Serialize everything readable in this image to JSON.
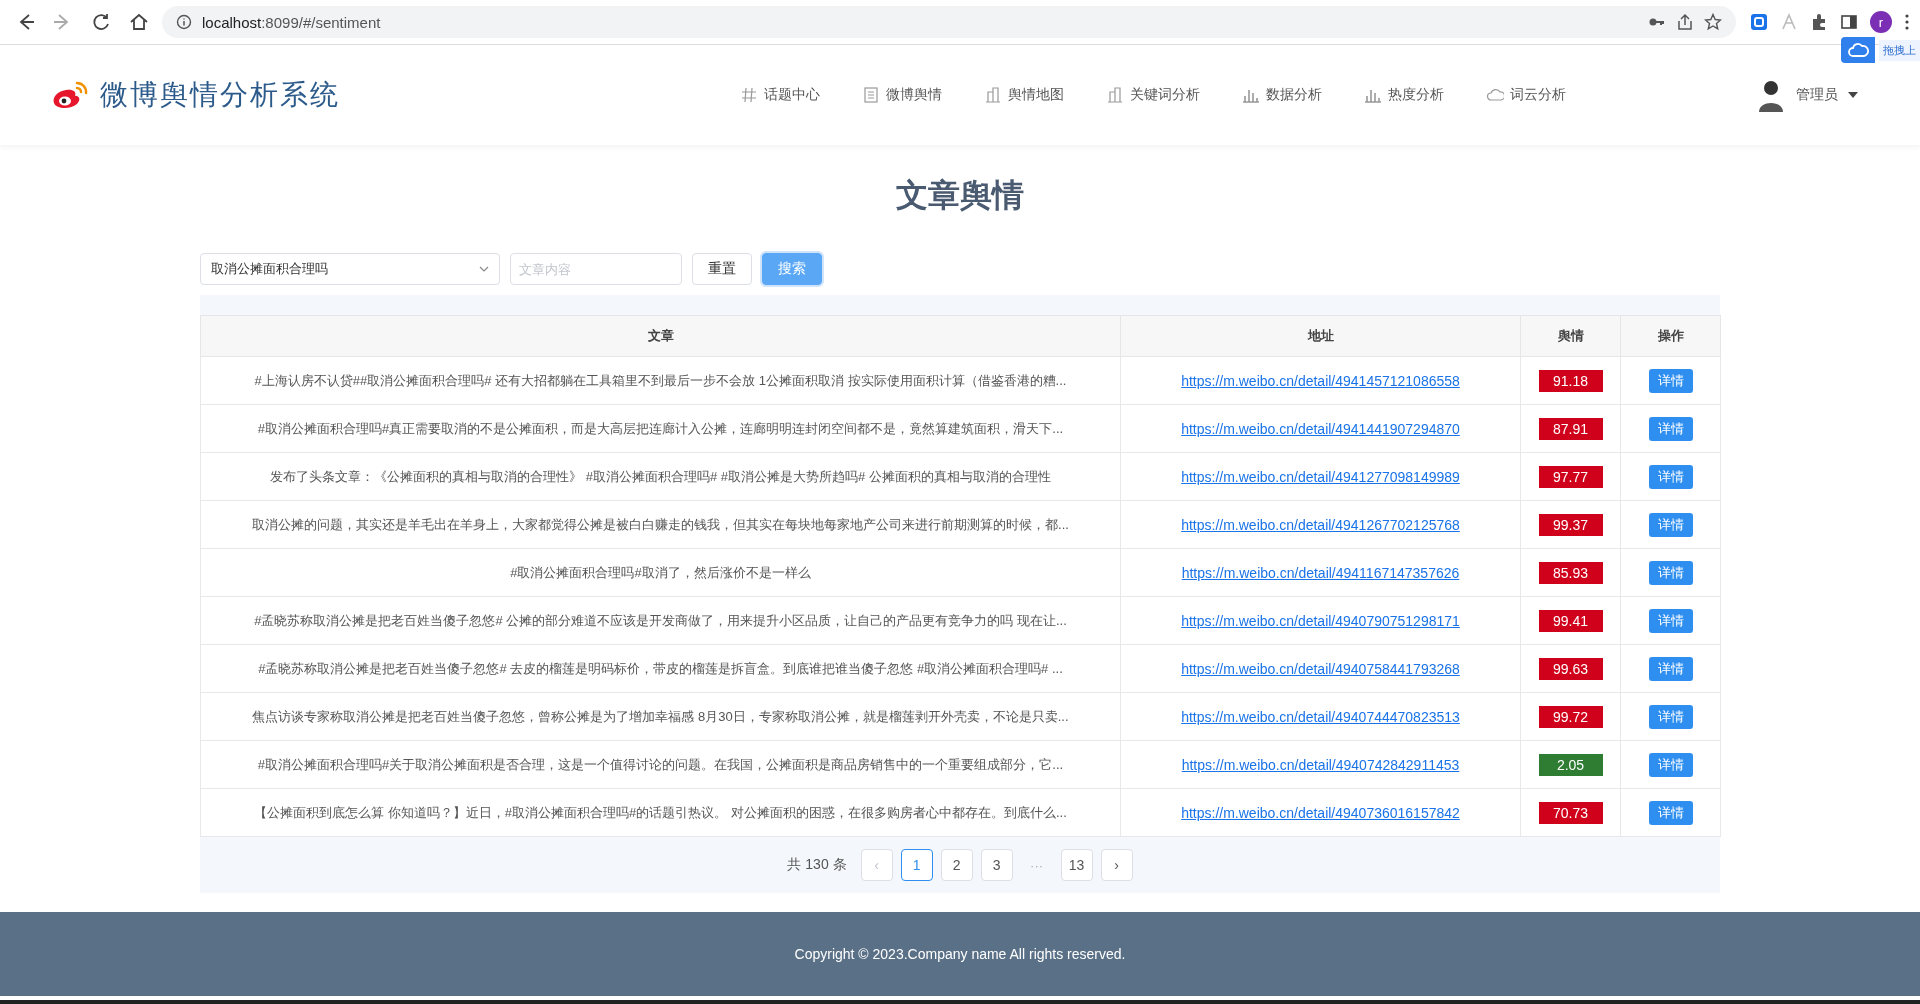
{
  "browser": {
    "url_host": "localhost",
    "url_rest": ":8099/#/sentiment",
    "profile": "r",
    "upload_tip": "拖拽上"
  },
  "header": {
    "logo_text": "微博舆情分析系统",
    "user": "管理员",
    "nav": [
      {
        "label": "话题中心"
      },
      {
        "label": "微博舆情"
      },
      {
        "label": "舆情地图"
      },
      {
        "label": "关键词分析"
      },
      {
        "label": "数据分析"
      },
      {
        "label": "热度分析"
      },
      {
        "label": "词云分析"
      }
    ]
  },
  "page_title": "文章舆情",
  "filters": {
    "topic": "取消公摊面积合理吗",
    "search_placeholder": "文章内容",
    "reset": "重置",
    "search": "搜索"
  },
  "table": {
    "columns": [
      "文章",
      "地址",
      "舆情",
      "操作"
    ],
    "rows": [
      {
        "article": "#上海认房不认贷##取消公摊面积合理吗# 还有大招都躺在工具箱里不到最后一步不会放 1公摊面积取消 按实际使用面积计算（借鉴香港的糟...",
        "url": "https://m.weibo.cn/detail/4941457121086558",
        "score": "91.18",
        "color": "#d0021b",
        "action": "详情"
      },
      {
        "article": "#取消公摊面积合理吗#真正需要取消的不是公摊面积，而是大高层把连廊计入公摊，连廊明明连封闭空间都不是，竟然算建筑面积，滑天下...",
        "url": "https://m.weibo.cn/detail/4941441907294870",
        "score": "87.91",
        "color": "#d0021b",
        "action": "详情"
      },
      {
        "article": "发布了头条文章：《公摊面积的真相与取消的合理性》 #取消公摊面积合理吗# #取消公摊是大势所趋吗# 公摊面积的真相与取消的合理性",
        "url": "https://m.weibo.cn/detail/4941277098149989",
        "score": "97.77",
        "color": "#d0021b",
        "action": "详情"
      },
      {
        "article": "取消公摊的问题，其实还是羊毛出在羊身上，大家都觉得公摊是被白白赚走的钱我，但其实在每块地每家地产公司来进行前期测算的时候，都...",
        "url": "https://m.weibo.cn/detail/4941267702125768",
        "score": "99.37",
        "color": "#d0021b",
        "action": "详情"
      },
      {
        "article": "#取消公摊面积合理吗#取消了，然后涨价不是一样么",
        "url": "https://m.weibo.cn/detail/4941167147357626",
        "score": "85.93",
        "color": "#d0021b",
        "action": "详情"
      },
      {
        "article": "#孟晓苏称取消公摊是把老百姓当傻子忽悠# 公摊的部分难道不应该是开发商做了，用来提升小区品质，让自己的产品更有竞争力的吗 现在让...",
        "url": "https://m.weibo.cn/detail/4940790751298171",
        "score": "99.41",
        "color": "#d0021b",
        "action": "详情"
      },
      {
        "article": "#孟晓苏称取消公摊是把老百姓当傻子忽悠# 去皮的榴莲是明码标价，带皮的榴莲是拆盲盒。到底谁把谁当傻子忽悠 #取消公摊面积合理吗# ...",
        "url": "https://m.weibo.cn/detail/4940758441793268",
        "score": "99.63",
        "color": "#d0021b",
        "action": "详情"
      },
      {
        "article": "焦点访谈专家称取消公摊是把老百姓当傻子忽悠，曾称公摊是为了增加幸福感 8月30日，专家称取消公摊，就是榴莲剥开外壳卖，不论是只卖...",
        "url": "https://m.weibo.cn/detail/4940744470823513",
        "score": "99.72",
        "color": "#d0021b",
        "action": "详情"
      },
      {
        "article": "#取消公摊面积合理吗#关于取消公摊面积是否合理，这是一个值得讨论的问题。在我国，公摊面积是商品房销售中的一个重要组成部分，它...",
        "url": "https://m.weibo.cn/detail/4940742842911453",
        "score": "2.05",
        "color": "#2e7d32",
        "action": "详情"
      },
      {
        "article": "【公摊面积到底怎么算 你知道吗？】近日，#取消公摊面积合理吗#的话题引热议。 对公摊面积的困惑，在很多购房者心中都存在。到底什么...",
        "url": "https://m.weibo.cn/detail/4940736016157842",
        "score": "70.73",
        "color": "#d0021b",
        "action": "详情"
      }
    ]
  },
  "pagination": {
    "total": "共 130 条",
    "prev": "‹",
    "next": "›",
    "pages": [
      {
        "label": "1",
        "selected": true,
        "kind": "page"
      },
      {
        "label": "2",
        "selected": false,
        "kind": "page"
      },
      {
        "label": "3",
        "selected": false,
        "kind": "page"
      },
      {
        "label": "···",
        "selected": false,
        "kind": "more"
      },
      {
        "label": "13",
        "selected": false,
        "kind": "page"
      }
    ]
  },
  "footer": "Copyright © 2023.Company name All rights reserved."
}
